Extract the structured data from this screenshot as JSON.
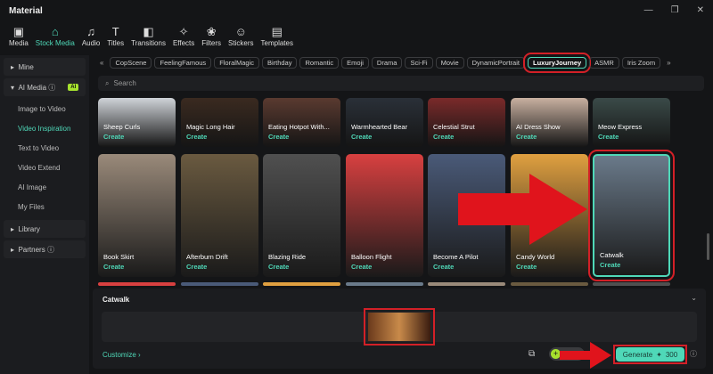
{
  "window": {
    "title": "Material"
  },
  "toolbar": [
    {
      "label": "Media",
      "icon": "▣"
    },
    {
      "label": "Stock Media",
      "icon": "⌂"
    },
    {
      "label": "Audio",
      "icon": "♫"
    },
    {
      "label": "Titles",
      "icon": "T"
    },
    {
      "label": "Transitions",
      "icon": "◧"
    },
    {
      "label": "Effects",
      "icon": "✧"
    },
    {
      "label": "Filters",
      "icon": "❀"
    },
    {
      "label": "Stickers",
      "icon": "☺"
    },
    {
      "label": "Templates",
      "icon": "▤"
    }
  ],
  "sidebar": {
    "mine": "Mine",
    "ai_media": "AI Media",
    "ai_badge": "AI",
    "items": [
      "Image to Video",
      "Video Inspiration",
      "Text to Video",
      "Video Extend",
      "AI Image",
      "My Files"
    ],
    "library": "Library",
    "partners": "Partners"
  },
  "tags": [
    "CopScene",
    "FeelingFamous",
    "FloralMagic",
    "Birthday",
    "Romantic",
    "Emoji",
    "Drama",
    "Sci-Fi",
    "Movie",
    "DynamicPortrait",
    "LuxuryJourney",
    "ASMR",
    "Iris Zoom"
  ],
  "search": {
    "placeholder": "Search"
  },
  "create_label": "Create",
  "row1": [
    "Sheep Curls",
    "Magic Long Hair",
    "Eating Hotpot With...",
    "Warmhearted Bear",
    "Celestial Strut",
    "AI Dress Show",
    "Meow Express"
  ],
  "row2": [
    "Book Skirt",
    "Afterburn Drift",
    "Blazing Ride",
    "Balloon Flight",
    "Become A Pilot",
    "Candy World",
    "Catwalk"
  ],
  "bottom": {
    "title": "Catwalk",
    "customize": "Customize",
    "generate": "Generate",
    "credits": "300"
  }
}
